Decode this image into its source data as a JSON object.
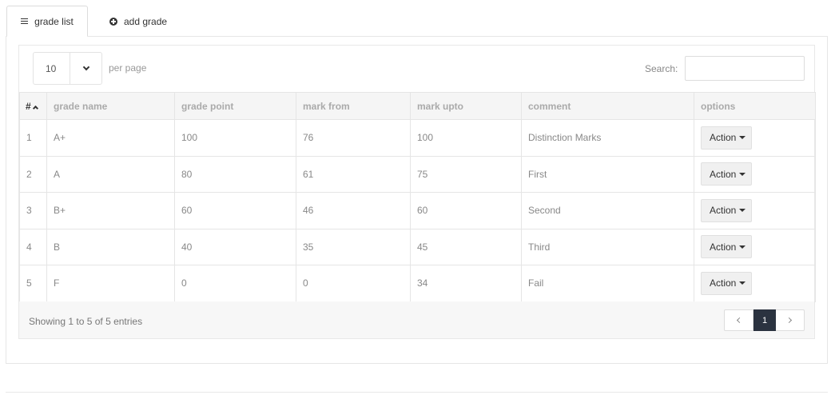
{
  "tabs": [
    {
      "label": "grade list",
      "icon": "menu-icon",
      "active": true
    },
    {
      "label": "add grade",
      "icon": "plus-circle-icon",
      "active": false
    }
  ],
  "length_menu": {
    "value": "10",
    "label": "per page"
  },
  "search": {
    "label": "Search:",
    "value": ""
  },
  "table": {
    "columns": [
      "#",
      "grade name",
      "grade point",
      "mark from",
      "mark upto",
      "comment",
      "options"
    ],
    "rows": [
      [
        "1",
        "A+",
        "100",
        "76",
        "100",
        "Distinction Marks"
      ],
      [
        "2",
        "A",
        "80",
        "61",
        "75",
        "First"
      ],
      [
        "3",
        "B+",
        "60",
        "46",
        "60",
        "Second"
      ],
      [
        "4",
        "B",
        "40",
        "35",
        "45",
        "Third"
      ],
      [
        "5",
        "F",
        "0",
        "0",
        "34",
        "Fail"
      ]
    ],
    "action_label": "Action"
  },
  "info": "Showing 1 to 5 of 5 entries",
  "pagination": {
    "current": "1"
  },
  "colors": {
    "accent": "#2b3340",
    "header_bg": "#f5f5f5"
  }
}
